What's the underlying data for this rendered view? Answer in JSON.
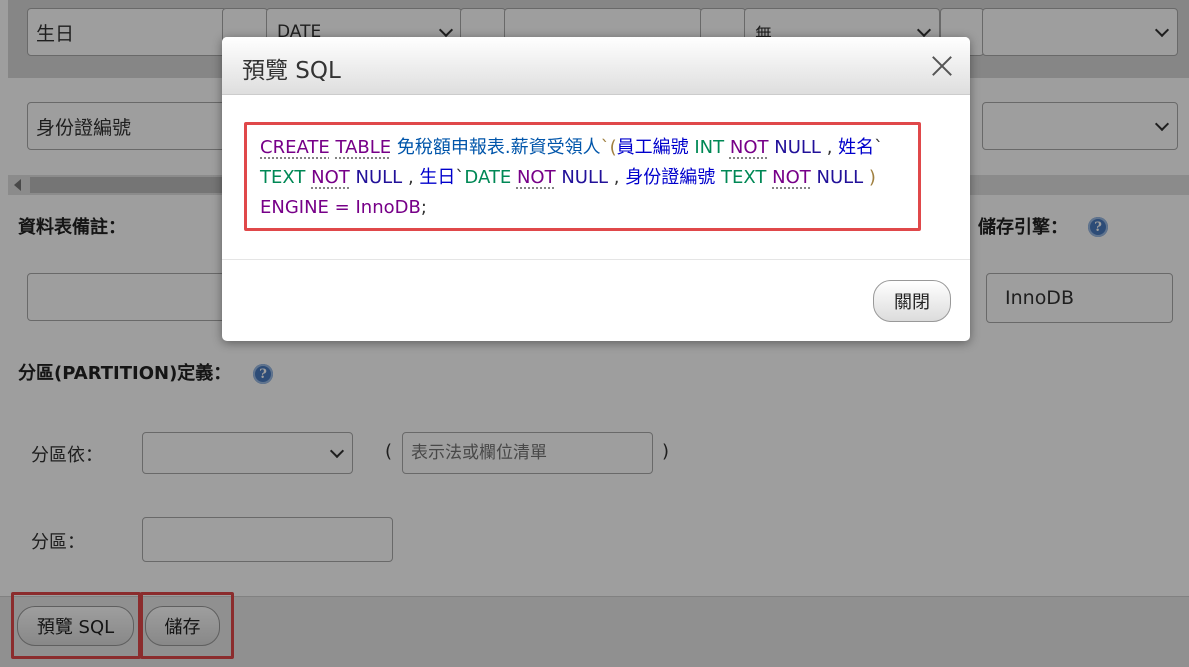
{
  "form": {
    "row1": {
      "name_value": "生日",
      "type_value": "DATE",
      "default_value": "無"
    },
    "row2": {
      "name_value": "身份證編號"
    },
    "table_comment_label": "資料表備註：",
    "engine_label": "儲存引擎：",
    "engine_value": "InnoDB",
    "partition_label": "分區(PARTITION)定義：",
    "partition_by_label": "分區依：",
    "paren_open": "(",
    "paren_close": ")",
    "expression_placeholder": "表示法或欄位清單",
    "partitions_label": "分區：",
    "help_glyph": "?"
  },
  "footer": {
    "preview_sql_label": "預覽 SQL",
    "save_label": "儲存"
  },
  "dialog": {
    "title": "預覽 SQL",
    "close_label": "關閉",
    "sql": {
      "create": "CREATE",
      "table": "TABLE",
      "table_name": "免稅額申報表.薪資受領人",
      "bt1": "`(",
      "c1": "員工編號",
      "t1": "INT",
      "not": "NOT",
      "null": "NULL",
      "comma": ",",
      "c2": "姓名",
      "bt2": "`",
      "t2": "TEXT",
      "c3": "生日",
      "bt3": "`",
      "t3": "DATE",
      "c4": "身份證編號",
      "t4": "TEXT",
      "close_paren": ")",
      "engine": "ENGINE",
      "eq": "=",
      "engine_name": "InnoDB",
      "semi": ";"
    }
  },
  "colors": {
    "highlight_box": "#e0484a",
    "keyword": "#770088",
    "type": "#008855"
  }
}
